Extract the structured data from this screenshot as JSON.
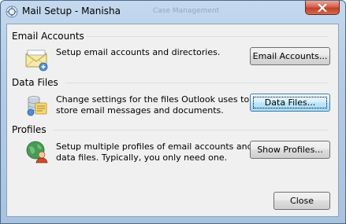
{
  "window": {
    "title": "Mail Setup - Manisha",
    "background_window_title": "Case Management",
    "close_button_icon": "close-x-icon",
    "app_icon": "mail-setup-icon"
  },
  "sections": {
    "email_accounts": {
      "label": "Email Accounts",
      "icon": "envelope-icon",
      "description_line1": "Setup email accounts and directories.",
      "button_label": "Email Accounts..."
    },
    "data_files": {
      "label": "Data Files",
      "icon": "data-files-icon",
      "description_line1": "Change settings for the files Outlook uses to",
      "description_line2": "store email messages and documents.",
      "button_label": "Data Files..."
    },
    "profiles": {
      "label": "Profiles",
      "icon": "profiles-icon",
      "description_line1": "Setup multiple profiles of email accounts and",
      "description_line2": "data files. Typically, you only need one.",
      "button_label": "Show Profiles..."
    }
  },
  "footer": {
    "close_label": "Close"
  },
  "colors": {
    "title_bar": "#b5cce5",
    "client_background": "#f0f0f0",
    "close_button": "#c23f28",
    "focused_button_border": "#3c7fb1"
  }
}
